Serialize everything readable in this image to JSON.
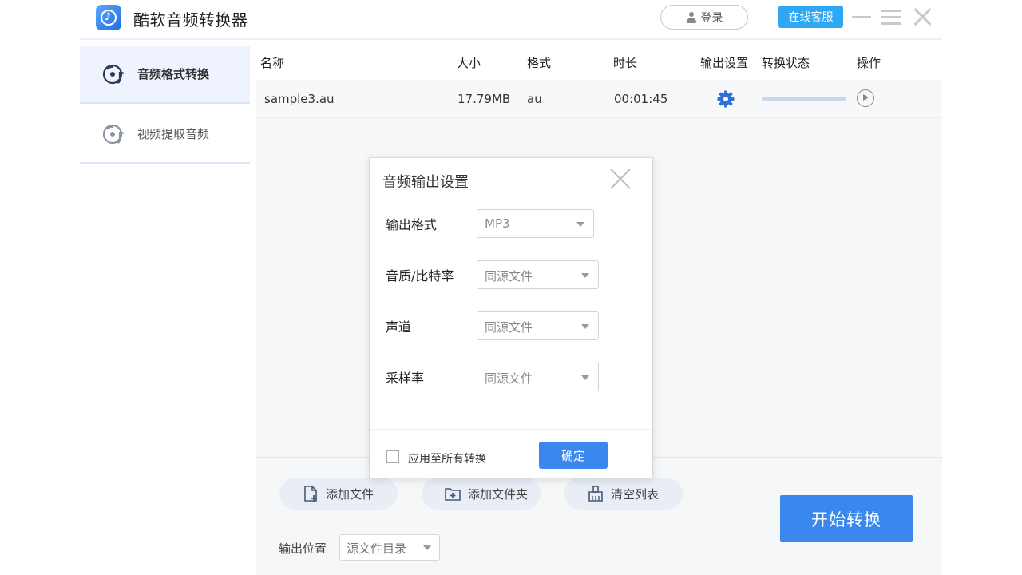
{
  "app": {
    "title": "酷软音频转换器",
    "login_label": "登录",
    "service_label": "在线客服"
  },
  "sidebar": {
    "items": [
      {
        "label": "音频格式转换",
        "active": true
      },
      {
        "label": "视频提取音频",
        "active": false
      }
    ]
  },
  "table": {
    "headers": {
      "name": "名称",
      "size": "大小",
      "format": "格式",
      "duration": "时长",
      "output": "输出设置",
      "status": "转换状态",
      "action": "操作"
    },
    "rows": [
      {
        "name": "sample3.au",
        "size": "17.79MB",
        "format": "au",
        "duration": "00:01:45",
        "progress": 0
      }
    ]
  },
  "bottom": {
    "add_file": "添加文件",
    "add_folder": "添加文件夹",
    "clear_list": "清空列表",
    "output_label": "输出位置",
    "output_value": "源文件目录",
    "start_label": "开始转换"
  },
  "dialog": {
    "title": "音频输出设置",
    "fields": [
      {
        "label": "输出格式",
        "value": "MP3"
      },
      {
        "label": "音质/比特率",
        "value": "同源文件"
      },
      {
        "label": "声道",
        "value": "同源文件"
      },
      {
        "label": "采样率",
        "value": "同源文件"
      }
    ],
    "apply_all_label": "应用至所有转换",
    "apply_all_checked": false,
    "ok_label": "确定"
  },
  "colors": {
    "accent": "#3a88ee",
    "service": "#2ea8f2",
    "sidebar_active": "#eef3fd"
  }
}
